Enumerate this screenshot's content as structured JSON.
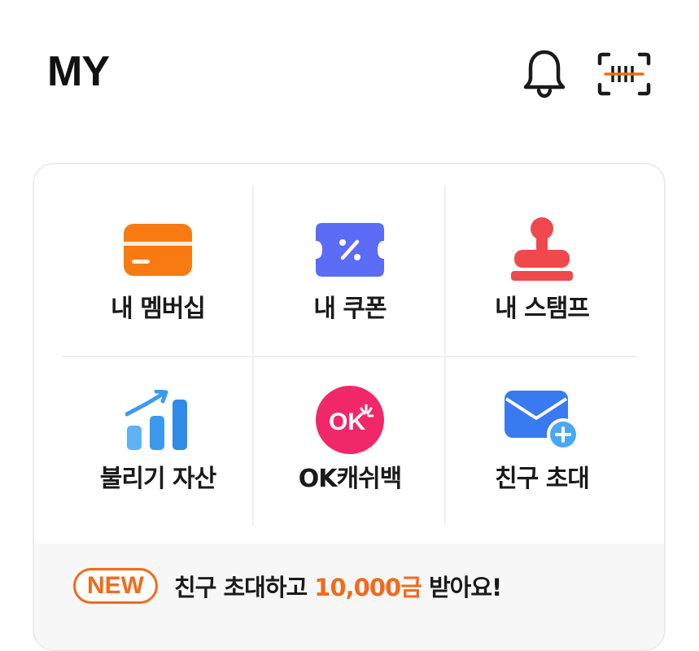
{
  "header": {
    "title": "MY",
    "bell_icon": "bell-icon",
    "barcode_icon": "barcode-scan-icon"
  },
  "menu": {
    "items": [
      {
        "label": "내 멤버십",
        "icon": "membership-card-icon",
        "color": "#f77b12"
      },
      {
        "label": "내 쿠폰",
        "icon": "coupon-ticket-icon",
        "color": "#5b6cf6"
      },
      {
        "label": "내 스탬프",
        "icon": "stamp-icon",
        "color": "#f0494d"
      },
      {
        "label": "불리기 자산",
        "icon": "growth-chart-icon",
        "color": "#3b9af0"
      },
      {
        "label": "OK캐쉬백",
        "icon": "ok-cashbag-icon",
        "color": "#f0286a"
      },
      {
        "label": "친구 초대",
        "icon": "invite-envelope-icon",
        "color": "#3a7af0"
      }
    ]
  },
  "promo": {
    "badge": "NEW",
    "text_before": "친구 초대하고 ",
    "amount": "10,000금",
    "text_after": " 받아요!",
    "accent_color": "#f26a1b"
  }
}
